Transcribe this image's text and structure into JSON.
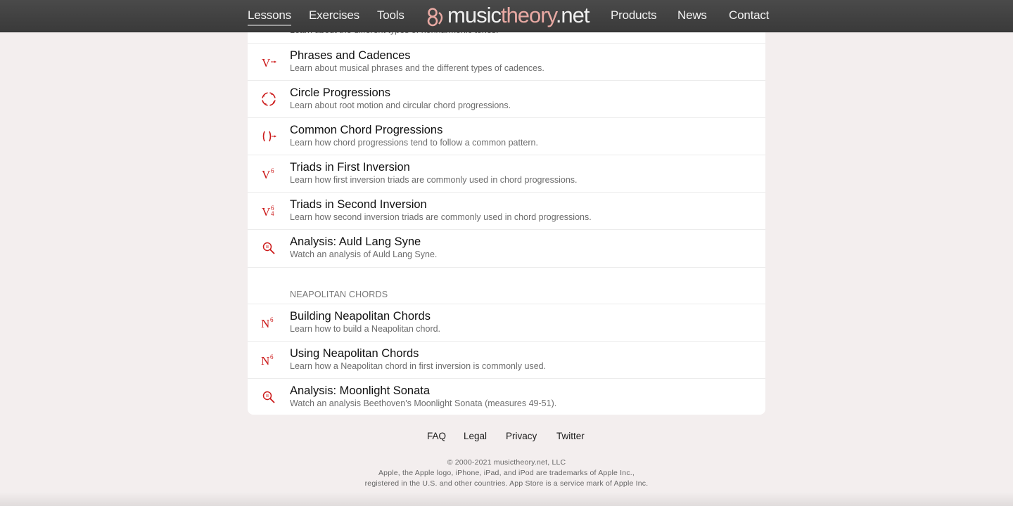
{
  "nav": {
    "lessons": "Lessons",
    "exercises": "Exercises",
    "tools": "Tools",
    "logo_music": "music",
    "logo_theory": "theory",
    "logo_net": ".net",
    "products": "Products",
    "news": "News",
    "contact": "Contact"
  },
  "partial_desc": "Learn about the different types of nonharmonic tones.",
  "lessons": [
    {
      "title": "Phrases and Cadences",
      "desc": "Learn about musical phrases and the different types of cadences.",
      "icon": "cadence-icon"
    },
    {
      "title": "Circle Progressions",
      "desc": "Learn about root motion and circular chord progressions.",
      "icon": "circle-progression-icon"
    },
    {
      "title": "Common Chord Progressions",
      "desc": "Learn how chord progressions tend to follow a common pattern.",
      "icon": "chord-progression-icon"
    },
    {
      "title": "Triads in First Inversion",
      "desc": "Learn how first inversion triads are commonly used in chord progressions.",
      "icon": "first-inversion-icon"
    },
    {
      "title": "Triads in Second Inversion",
      "desc": "Learn how second inversion triads are commonly used in chord progressions.",
      "icon": "second-inversion-icon"
    },
    {
      "title": "Analysis: Auld Lang Syne",
      "desc": "Watch an analysis of Auld Lang Syne.",
      "icon": "analysis-magnifier-icon"
    }
  ],
  "section_neapolitan": "NEAPOLITAN CHORDS",
  "neapolitan_lessons": [
    {
      "title": "Building Neapolitan Chords",
      "desc": "Learn how to build a Neapolitan chord.",
      "icon": "neapolitan-icon"
    },
    {
      "title": "Using Neapolitan Chords",
      "desc": "Learn how a Neapolitan chord in first inversion is commonly used.",
      "icon": "neapolitan-icon"
    },
    {
      "title": "Analysis: Moonlight Sonata",
      "desc": "Watch an analysis Beethoven's Moonlight Sonata (measures 49-51).",
      "icon": "analysis-magnifier-icon"
    }
  ],
  "footer": {
    "faq": "FAQ",
    "legal": "Legal",
    "privacy": "Privacy",
    "twitter": "Twitter",
    "copyright": "© 2000-2021 musictheory.net, LLC",
    "trademark1": "Apple, the Apple logo, iPhone, iPad, and iPod are trademarks of Apple Inc.,",
    "trademark2": "registered in the U.S. and other countries. App Store is a service mark of Apple Inc."
  },
  "icon_glyphs": {
    "roman_v": "V",
    "roman_n": "N",
    "sup_6": "6",
    "sup_4": "4"
  },
  "colors": {
    "accent": "#cc1a1a",
    "logo_theory": "#e8a9a3",
    "navbar": "#404040",
    "background": "#f3eeee"
  }
}
